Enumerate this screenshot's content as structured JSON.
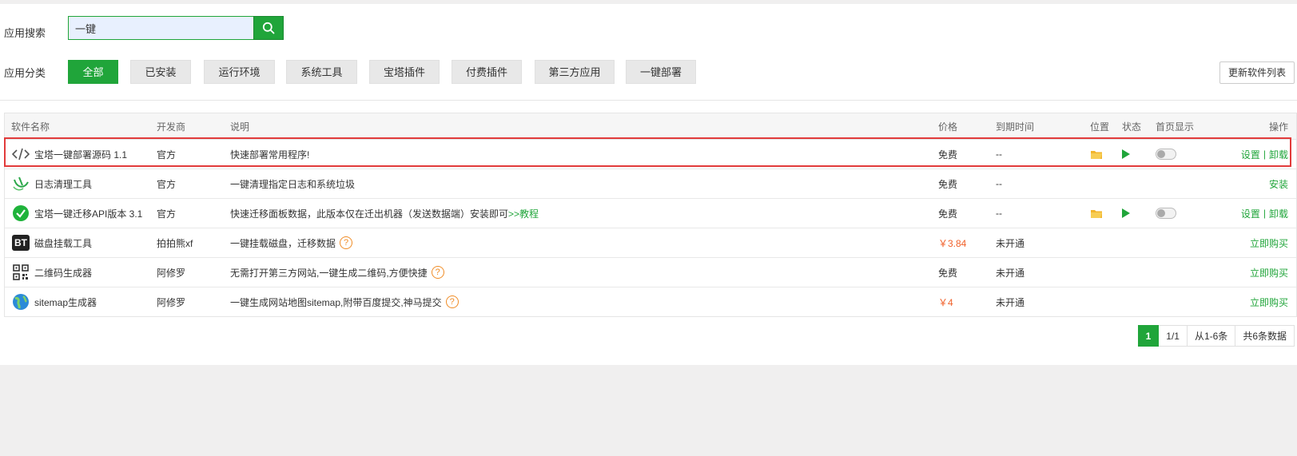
{
  "search": {
    "label": "应用搜索",
    "value": "一键"
  },
  "category": {
    "label": "应用分类",
    "buttons": [
      "全部",
      "已安装",
      "运行环境",
      "系统工具",
      "宝塔插件",
      "付费插件",
      "第三方应用",
      "一键部署"
    ],
    "active_index": 0
  },
  "update_button": "更新软件列表",
  "table": {
    "headers": {
      "name": "软件名称",
      "developer": "开发商",
      "description": "说明",
      "price": "价格",
      "expire": "到期时间",
      "position": "位置",
      "status": "状态",
      "home": "首页显示",
      "operation": "操作"
    },
    "rows": [
      {
        "icon": "code-icon",
        "name": "宝塔一键部署源码 1.1",
        "developer": "官方",
        "description": "快速部署常用程序!",
        "price": "免费",
        "expire": "--",
        "op1": "设置",
        "sep": "|",
        "op2": "卸载"
      },
      {
        "icon": "broom-icon",
        "name": "日志清理工具",
        "developer": "官方",
        "description": "一键清理指定日志和系统垃圾",
        "price": "免费",
        "expire": "--",
        "op1": "安装"
      },
      {
        "icon": "check-circle-icon",
        "name": "宝塔一键迁移API版本 3.1",
        "developer": "官方",
        "description": "快速迁移面板数据，此版本仅在迁出机器（发送数据端）安装即可",
        "desc_link": ">>教程",
        "price": "免费",
        "expire": "--",
        "op1": "设置",
        "sep": "|",
        "op2": "卸载"
      },
      {
        "icon": "bt-logo-icon",
        "icon_text": "BT",
        "name": "磁盘挂载工具",
        "developer": "拍拍熊xf",
        "description": "一键挂载磁盘，迁移数据",
        "price": "￥3.84",
        "expire": "未开通",
        "op1": "立即购买"
      },
      {
        "icon": "qrcode-icon",
        "name": "二维码生成器",
        "developer": "阿修罗",
        "description": "无需打开第三方网站,一键生成二维码,方便快捷",
        "price": "免费",
        "expire": "未开通",
        "op1": "立即购买"
      },
      {
        "icon": "globe-icon",
        "name": "sitemap生成器",
        "developer": "阿修罗",
        "description": "一键生成网站地图sitemap,附带百度提交,神马提交",
        "price": "￥4",
        "expire": "未开通",
        "op1": "立即购买"
      }
    ]
  },
  "pager": {
    "current": "1",
    "pages": "1/1",
    "range": "从1-6条",
    "total": "共6条数据"
  },
  "colors": {
    "accent": "#20a53a",
    "price_paid": "#f0602a",
    "highlight": "#e23b3b"
  }
}
